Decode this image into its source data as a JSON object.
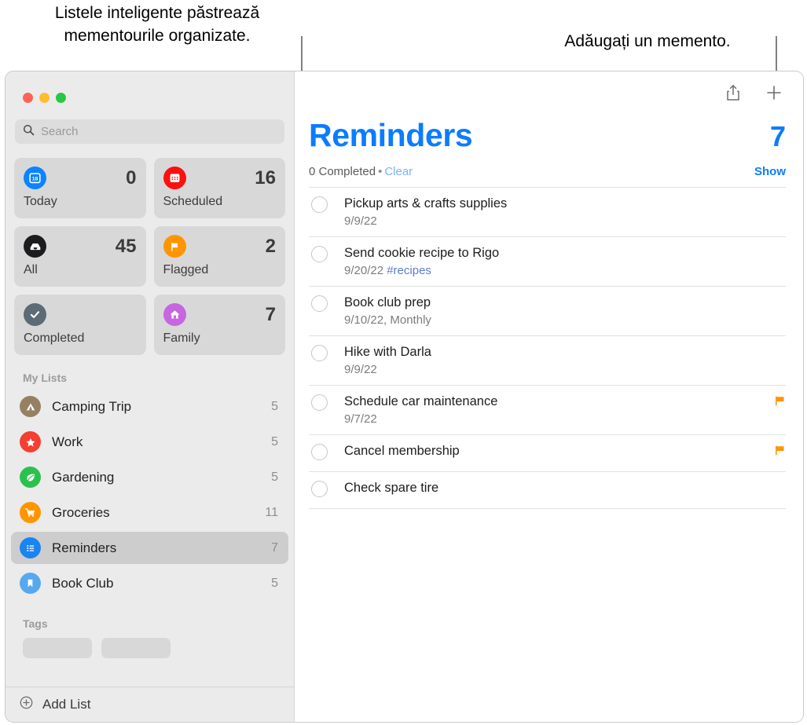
{
  "annotations": {
    "left": "Listele inteligente păstrează\nmementourile organizate.",
    "right": "Adăugați un memento."
  },
  "window": {
    "traffic_lights": [
      {
        "name": "close",
        "color": "#ff6159"
      },
      {
        "name": "minimize",
        "color": "#ffbd2e"
      },
      {
        "name": "zoom",
        "color": "#28c840"
      }
    ]
  },
  "sidebar": {
    "search": {
      "placeholder": "Search",
      "value": ""
    },
    "smart_lists": [
      {
        "id": "today",
        "label": "Today",
        "count": "0",
        "icon": "calendar-day-icon",
        "color": "#0a84ff"
      },
      {
        "id": "scheduled",
        "label": "Scheduled",
        "count": "16",
        "icon": "calendar-icon",
        "color": "#ff0f0f"
      },
      {
        "id": "all",
        "label": "All",
        "count": "45",
        "icon": "inbox-tray-icon",
        "color": "#1c1c1e"
      },
      {
        "id": "flagged",
        "label": "Flagged",
        "count": "2",
        "icon": "flag-icon",
        "color": "#ff9500"
      },
      {
        "id": "completed",
        "label": "Completed",
        "count": "",
        "icon": "checkmark-icon",
        "color": "#5c6b76"
      },
      {
        "id": "family",
        "label": "Family",
        "count": "7",
        "icon": "house-icon",
        "color": "#c666e0"
      }
    ],
    "my_lists_heading": "My Lists",
    "my_lists": [
      {
        "id": "camping-trip",
        "label": "Camping Trip",
        "count": "5",
        "icon": "tent-icon",
        "color": "#958162",
        "selected": false
      },
      {
        "id": "work",
        "label": "Work",
        "count": "5",
        "icon": "star-icon",
        "color": "#f43f32",
        "selected": false
      },
      {
        "id": "gardening",
        "label": "Gardening",
        "count": "5",
        "icon": "leaf-icon",
        "color": "#2bc14e",
        "selected": false
      },
      {
        "id": "groceries",
        "label": "Groceries",
        "count": "11",
        "icon": "cart-icon",
        "color": "#ff9500",
        "selected": false
      },
      {
        "id": "reminders",
        "label": "Reminders",
        "count": "7",
        "icon": "list-icon",
        "color": "#1a84f0",
        "selected": true
      },
      {
        "id": "book-club",
        "label": "Book Club",
        "count": "5",
        "icon": "bookmark-icon",
        "color": "#56a9ef",
        "selected": false
      }
    ],
    "tags_heading": "Tags",
    "tags": [
      "",
      ""
    ],
    "add_list_label": "Add List"
  },
  "main": {
    "toolbar": {
      "share_icon": "share-icon",
      "add_icon": "plus-icon"
    },
    "title": "Reminders",
    "total_count": "7",
    "completed_text": "0 Completed",
    "separator": "•",
    "clear_label": "Clear",
    "show_label": "Show",
    "accent_color": "#0b7cff",
    "reminders": [
      {
        "title": "Pickup arts & crafts supplies",
        "date": "9/9/22",
        "tag": "",
        "flagged": false
      },
      {
        "title": "Send cookie recipe to Rigo",
        "date": "9/20/22",
        "tag": "#recipes",
        "flagged": false
      },
      {
        "title": "Book club prep",
        "date": "9/10/22, Monthly",
        "tag": "",
        "flagged": false
      },
      {
        "title": "Hike with Darla",
        "date": "9/9/22",
        "tag": "",
        "flagged": false
      },
      {
        "title": "Schedule car maintenance",
        "date": "9/7/22",
        "tag": "",
        "flagged": true
      },
      {
        "title": "Cancel membership",
        "date": "",
        "tag": "",
        "flagged": true
      },
      {
        "title": "Check spare tire",
        "date": "",
        "tag": "",
        "flagged": false
      }
    ]
  }
}
